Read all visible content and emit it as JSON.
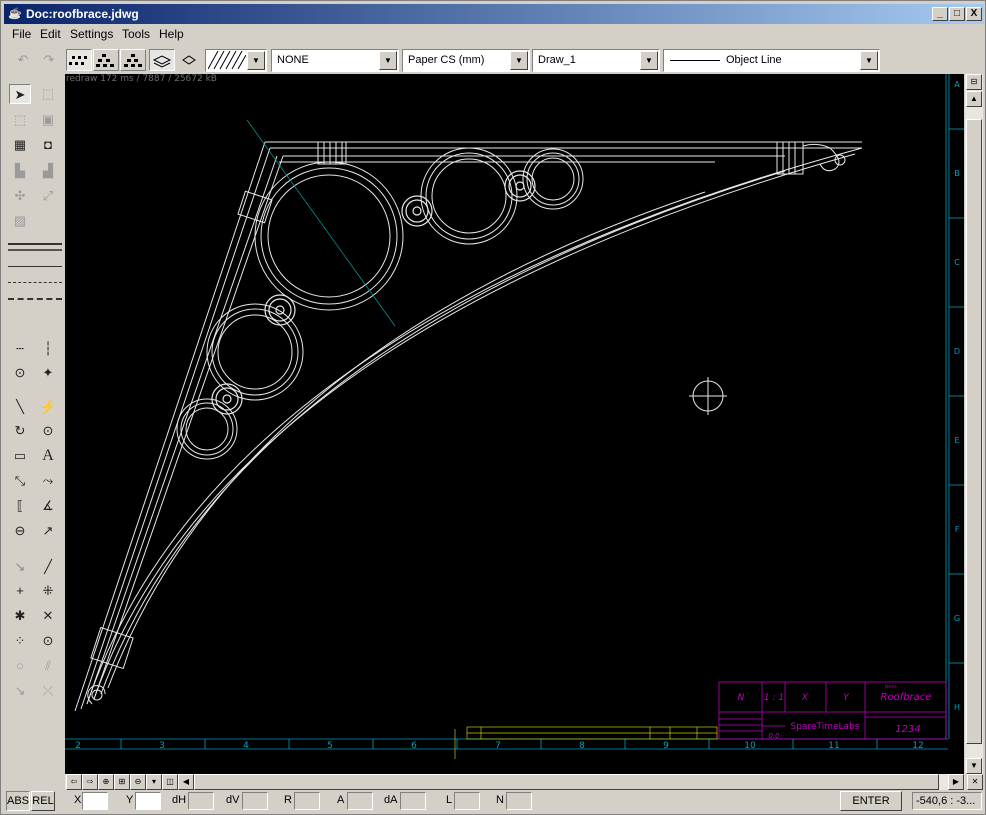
{
  "window": {
    "title": "Doc:roofbrace.jdwg",
    "buttons": [
      "_",
      "□",
      "X"
    ]
  },
  "menu": [
    "File",
    "Edit",
    "Settings",
    "Tools",
    "Help"
  ],
  "toolbar": {
    "hatch": "",
    "fill": "NONE",
    "coord_system": "Paper CS (mm)",
    "layer": "Draw_1",
    "linetype": "Object Line"
  },
  "canvas": {
    "redraw_info": "redraw 172 ms / 7887 / 25672 kB",
    "bottom_ruler": [
      "2",
      "3",
      "4",
      "5",
      "6",
      "7",
      "8",
      "9",
      "10",
      "11",
      "12"
    ],
    "side_ruler": [
      "A",
      "B",
      "C",
      "D",
      "E",
      "F",
      "G",
      "H"
    ]
  },
  "title_block": {
    "title_label": "Name",
    "title": "Roofbrace",
    "company": "SpareTimeLabs",
    "drawing_no": "1234",
    "scale": "1 : 1",
    "n_value": "N",
    "x_value": "X",
    "y_value": "Y",
    "small_value": "0.0"
  },
  "statusbar": {
    "abs": "ABS",
    "rel": "REL",
    "fields": [
      "X",
      "Y",
      "dH",
      "dV",
      "R",
      "A",
      "dA",
      "L",
      "N"
    ],
    "enter": "ENTER",
    "coords": "-540,6 : -3..."
  },
  "colors": {
    "canvas_bg": "#000000",
    "drawing": "#e8e8e8",
    "ruler": "#00a0c0",
    "titleblock": "#c000c0",
    "annotation": "#c8c800"
  }
}
